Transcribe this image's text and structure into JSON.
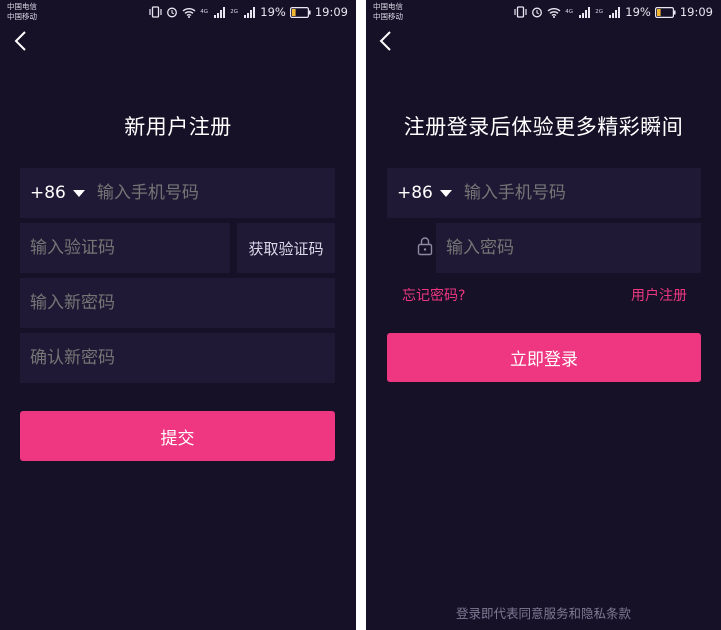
{
  "status": {
    "carrier_1": "中国电信",
    "carrier_2": "中国移动",
    "net_4g": "4G",
    "net_2g": "2G",
    "battery": "19%",
    "time": "19:09"
  },
  "register": {
    "title": "新用户注册",
    "country_code": "+86",
    "phone_placeholder": "输入手机号码",
    "code_placeholder": "输入验证码",
    "get_code_label": "获取验证码",
    "new_password_placeholder": "输入新密码",
    "confirm_password_placeholder": "确认新密码",
    "submit_label": "提交"
  },
  "login": {
    "title": "注册登录后体验更多精彩瞬间",
    "country_code": "+86",
    "phone_placeholder": "输入手机号码",
    "password_placeholder": "输入密码",
    "forgot_label": "忘记密码?",
    "register_label": "用户注册",
    "login_label": "立即登录",
    "terms_text": "登录即代表同意服务和隐私条款"
  },
  "colors": {
    "background": "#161127",
    "field": "#1f1935",
    "accent": "#ee3681",
    "placeholder": "#6e6886"
  }
}
